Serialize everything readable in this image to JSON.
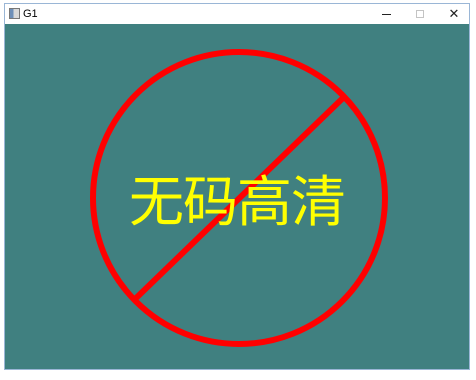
{
  "window": {
    "title": "G1",
    "controls": {
      "minimize_icon": "minimize-icon",
      "maximize_icon": "maximize-icon",
      "close_icon": "close-icon",
      "close_glyph": "✕"
    }
  },
  "canvas": {
    "background_color": "#408080",
    "sign": {
      "text": "无码高清",
      "text_color": "#ffff00",
      "stroke_color": "#ff0000",
      "symbol": "prohibition-sign"
    }
  }
}
